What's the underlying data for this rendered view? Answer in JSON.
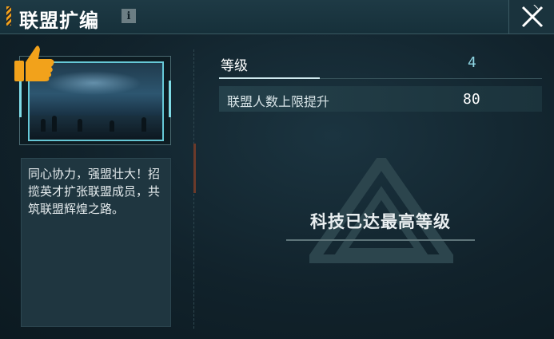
{
  "header": {
    "title": "联盟扩编",
    "info_icon": "i"
  },
  "left_panel": {
    "image_name": "alliance-hall-image",
    "description": "同心协力，强盟壮大！招揽英才扩张联盟成员，共筑联盟辉煌之路。"
  },
  "stats": {
    "level_label": "等级",
    "level_value": "4",
    "member_cap_label": "联盟人数上限提升",
    "member_cap_value": "80"
  },
  "status": {
    "maxed_text": "科技已达最高等级"
  },
  "colors": {
    "accent": "#8fd6e4",
    "frame": "#66c8d6",
    "thumb": "#f2a21b"
  },
  "icons": [
    "thumbs-up-icon",
    "info-icon",
    "close-icon",
    "alliance-emblem-icon"
  ]
}
